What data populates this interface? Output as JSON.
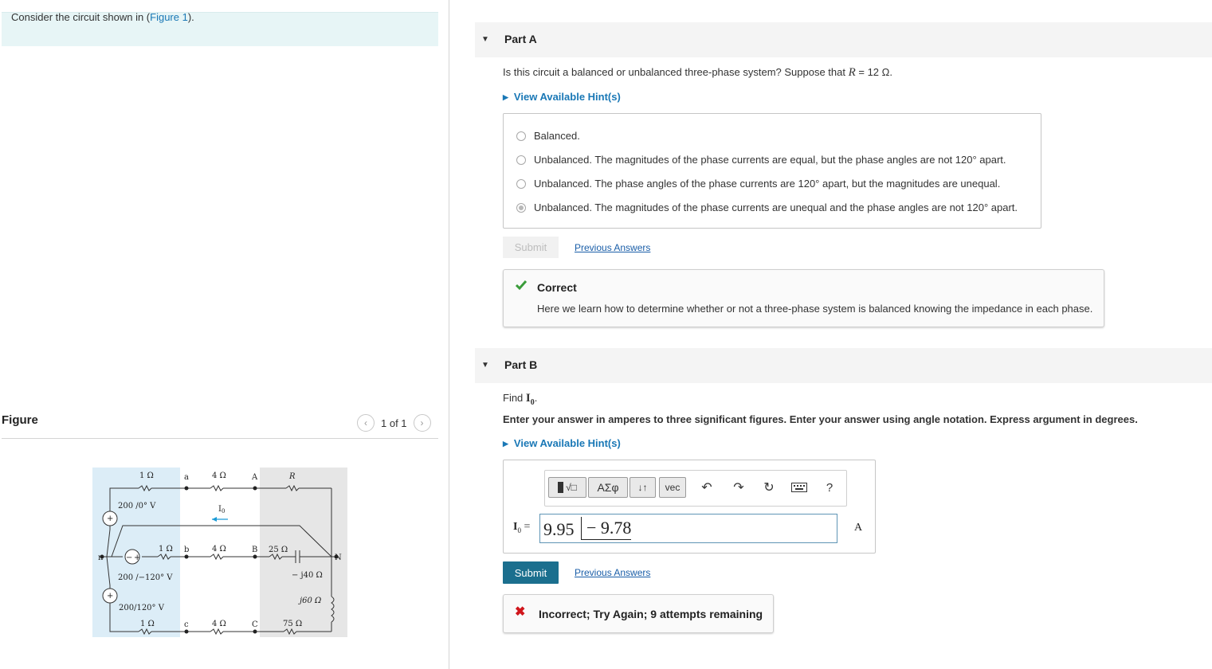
{
  "left": {
    "intro": {
      "prefix": "Consider the circuit shown in (",
      "link": "Figure 1",
      "suffix": ")."
    },
    "figure_title": "Figure",
    "pager": {
      "prev_icon": "chevron-left-icon",
      "text": "1 of 1",
      "next_icon": "chevron-right-icon"
    },
    "circuit": {
      "r1a": "1 Ω",
      "node_a": "a",
      "r4a": "4 Ω",
      "node_A": "A",
      "R": "R",
      "src1": "200 /0° V",
      "plus": "+",
      "minus": "−",
      "io": "I",
      "io_sub": "0",
      "node_n": "n",
      "r1b": "1 Ω",
      "node_b": "b",
      "r4b": "4 Ω",
      "node_B": "B",
      "r25": "25 Ω",
      "node_N": "N",
      "src2": "200 /−120° V",
      "cap": "− j40 Ω",
      "ind": "j60 Ω",
      "src3": "200/120° V",
      "r1c": "1 Ω",
      "node_c": "c",
      "r4c": "4 Ω",
      "node_C": "C",
      "r75": "75 Ω"
    }
  },
  "partA": {
    "label": "Part A",
    "question_prefix": "Is this circuit a balanced or unbalanced three-phase system? Suppose that ",
    "question_var": "R",
    "question_suffix": " = 12 Ω.",
    "hint": "View Available Hint(s)",
    "options": [
      "Balanced.",
      "Unbalanced. The magnitudes of the phase currents are equal, but the phase angles are not 120° apart.",
      "Unbalanced. The phase angles of the phase currents are 120° apart, but the magnitudes are unequal.",
      "Unbalanced. The magnitudes of the phase currents are unequal and the phase angles are not 120° apart."
    ],
    "selected_index": 3,
    "submit": "Submit",
    "previous_answers": "Previous Answers",
    "feedback": {
      "title": "Correct",
      "message": "Here we learn how to determine whether or not a three-phase system is balanced knowing the impedance in each phase."
    }
  },
  "partB": {
    "label": "Part B",
    "find_prefix": "Find ",
    "find_var": "I",
    "find_sub": "0",
    "find_suffix": ".",
    "instructions": "Enter your answer in amperes to three significant figures. Enter your answer using angle notation. Express argument in degrees.",
    "hint": "View Available Hint(s)",
    "toolbar": {
      "templates_label": "√□",
      "greek_label": "ΑΣφ",
      "arrows_label": "↓↑",
      "vec_label": "vec",
      "help_label": "?",
      "icons": [
        "undo-icon",
        "redo-icon",
        "reset-icon",
        "keyboard-icon"
      ]
    },
    "answer_label": "I",
    "answer_sub": "0",
    "answer_eq": " =",
    "answer_magnitude": "9.95",
    "answer_angle": "− 9.78",
    "unit": "A",
    "submit": "Submit",
    "previous_answers": "Previous Answers",
    "feedback": "Incorrect; Try Again; 9 attempts remaining"
  }
}
